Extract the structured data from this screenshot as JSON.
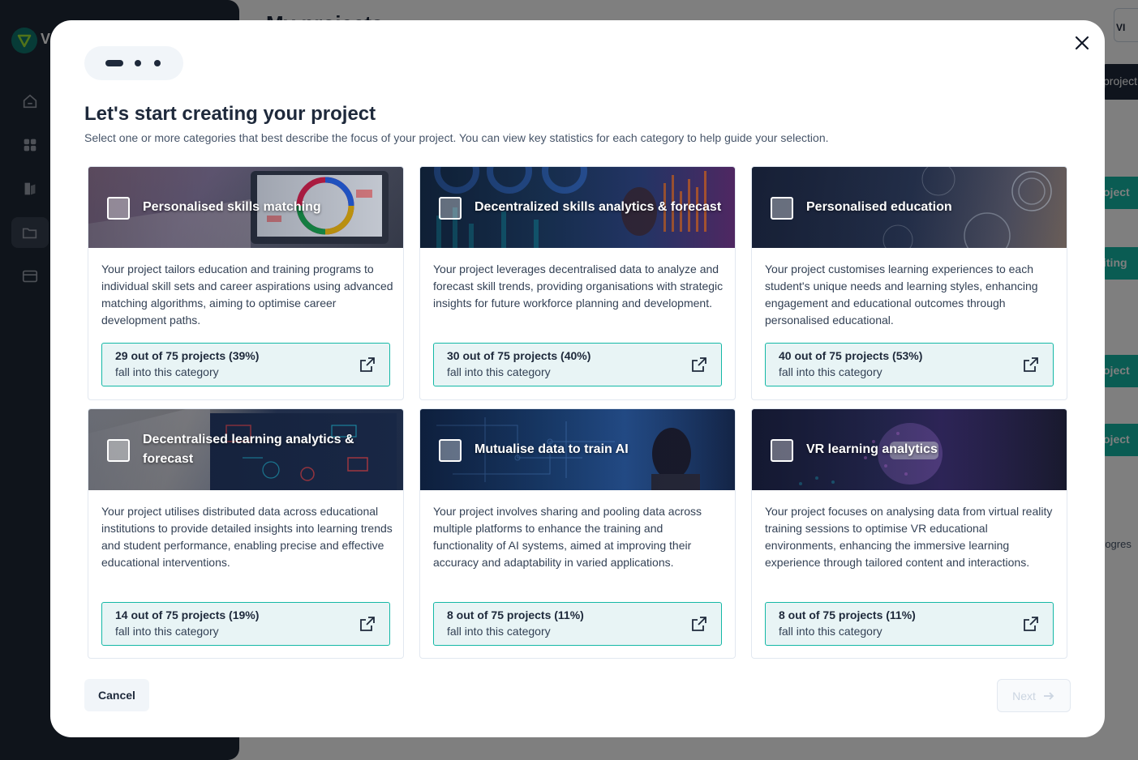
{
  "background": {
    "app_letter": "V",
    "page_title": "My projects",
    "top_right_label": "VI",
    "right_buttons": [
      "project",
      "oject",
      "iting",
      "oject",
      "oject"
    ],
    "progress_label": "rogres"
  },
  "modal": {
    "title": "Let's start creating your project",
    "subtitle": "Select one or more categories that best describe the focus of your project. You can view key statistics for each category to help guide your selection.",
    "cancel_label": "Cancel",
    "next_label": "Next",
    "categories": [
      {
        "title": "Personalised skills matching",
        "description": "Your project tailors education and training programs to individual skill sets and career aspirations using advanced matching algorithms, aiming to optimise career development paths.",
        "stat_main": "29 out of 75 projects (39%)",
        "stat_sub": "fall into this category"
      },
      {
        "title": "Decentralized skills analytics & forecast",
        "description": "Your project leverages decentralised data to analyze and forecast skill trends, providing organisations with strategic insights for future workforce planning and development.",
        "stat_main": "30 out of 75 projects (40%)",
        "stat_sub": "fall into this category"
      },
      {
        "title": "Personalised education",
        "description": "Your project customises learning experiences to each student's unique needs and learning styles, enhancing engagement and educational outcomes through personalised educational.",
        "stat_main": "40 out of 75 projects (53%)",
        "stat_sub": "fall into this category"
      },
      {
        "title": "Decentralised learning analytics & forecast",
        "description": "Your project utilises distributed data across educational institutions to provide detailed insights into learning trends and student performance, enabling precise and effective educational interventions.",
        "stat_main": "14 out of 75 projects (19%)",
        "stat_sub": "fall into this category"
      },
      {
        "title": "Mutualise data to train AI",
        "description": "Your project involves sharing and pooling data across multiple platforms to enhance the training and functionality of AI systems, aimed at improving their accuracy and adaptability in varied applications.",
        "stat_main": "8 out of 75 projects (11%)",
        "stat_sub": "fall into this category"
      },
      {
        "title": "VR learning analytics",
        "description": "Your project focuses on analysing data from virtual reality training sessions to optimise VR educational environments, enhancing the immersive learning experience through tailored content and interactions.",
        "stat_main": "8 out of 75 projects (11%)",
        "stat_sub": "fall into this category"
      }
    ]
  },
  "colors": {
    "accent": "#14b8a6",
    "dark": "#1e293b",
    "stat_bg": "#e8f4f5"
  },
  "icons": [
    "close-icon",
    "external-link-icon",
    "arrow-right-icon",
    "home-icon",
    "grid-icon",
    "book-icon",
    "folder-icon",
    "cv-icon",
    "logo-icon"
  ]
}
